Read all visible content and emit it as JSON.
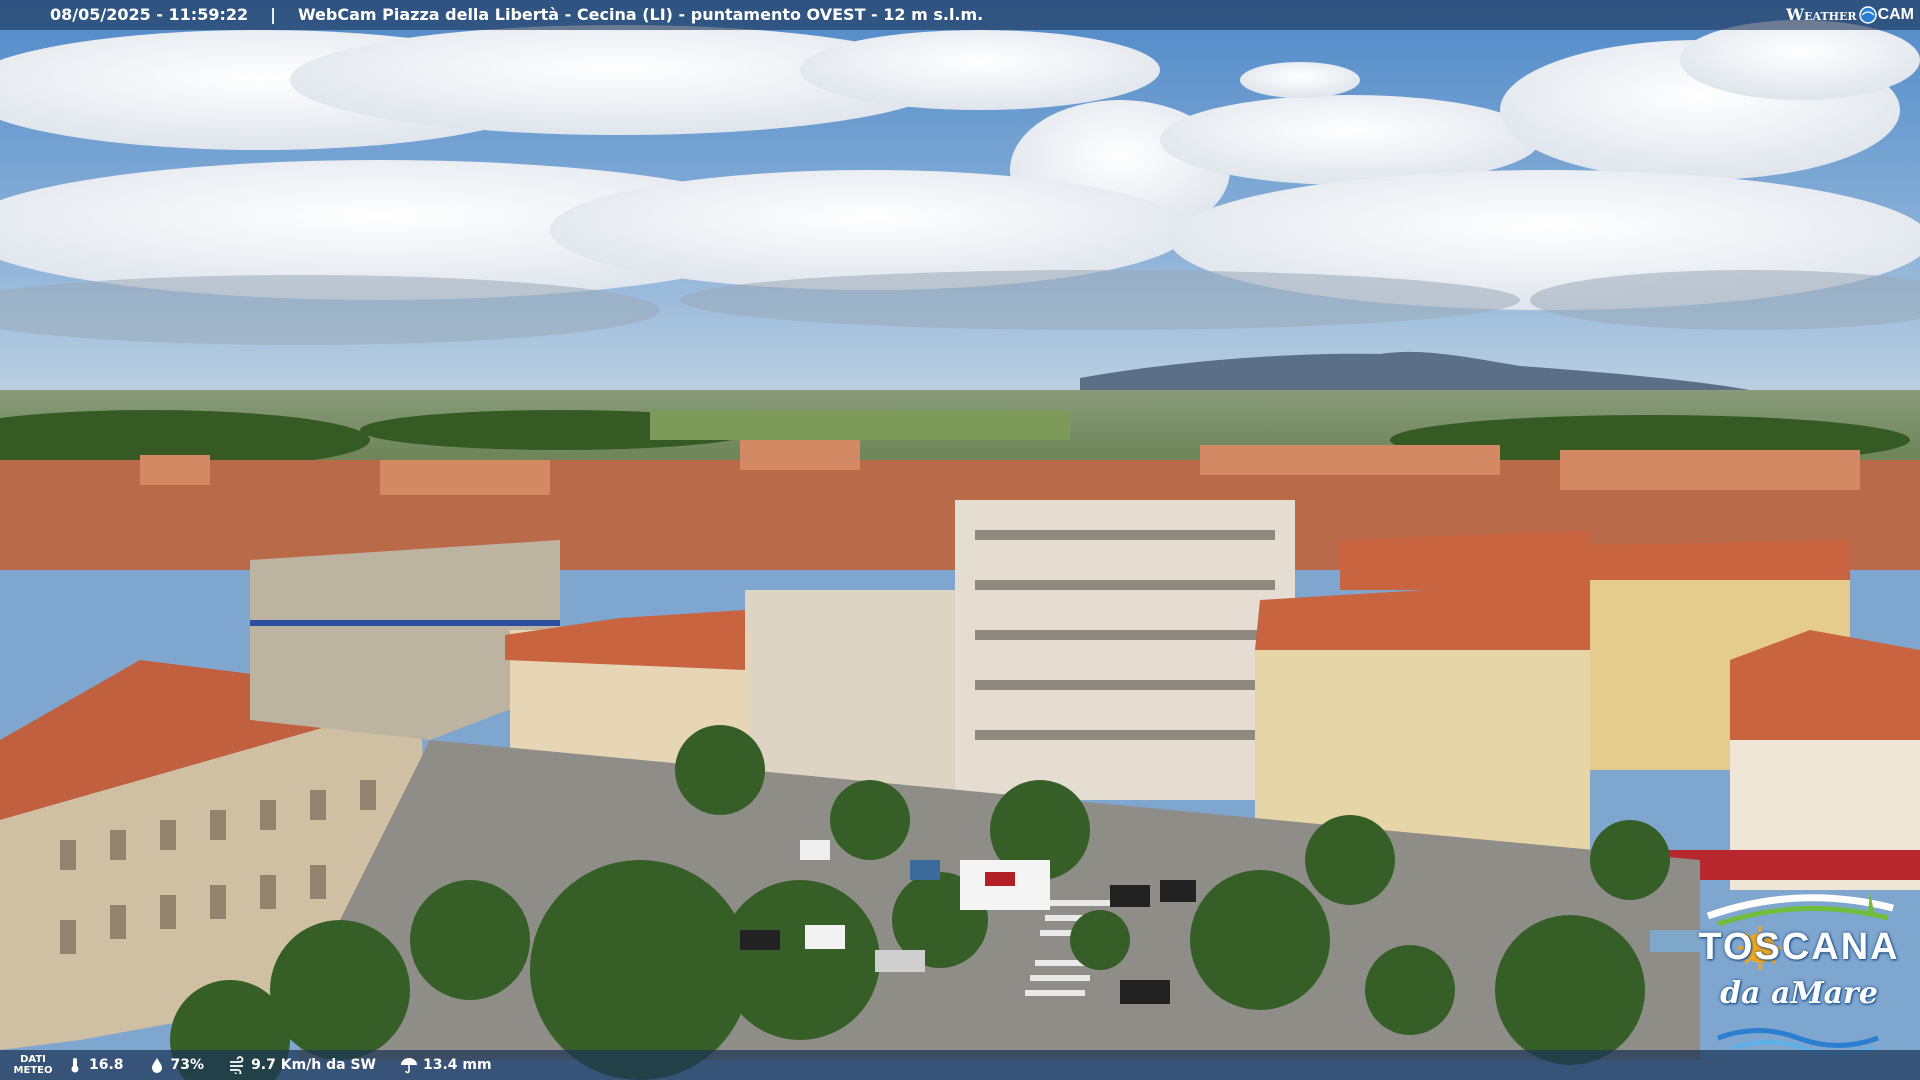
{
  "overlay": {
    "timestamp": "08/05/2025 - 11:59:22",
    "separator": "|",
    "caption": "WebCam Piazza della Libertà - Cecina (LI) - puntamento OVEST - 12 m s.l.m.",
    "logo_part1": "Weather",
    "logo_part2": "CAM",
    "logo_icon": "weathercam-globe-icon"
  },
  "meteo": {
    "label_line1": "DATI",
    "label_line2": "METEO",
    "temperature": "16.8",
    "temperature_icon": "thermometer-icon",
    "humidity": "73%",
    "humidity_icon": "droplet-icon",
    "wind": "9.7 Km/h da SW",
    "wind_icon": "wind-icon",
    "rain": "13.4 mm",
    "rain_icon": "umbrella-icon"
  },
  "brand": {
    "title": "TOSCANA",
    "subtitle": "da aMare",
    "icon": "sun-wave-icon"
  },
  "colors": {
    "sky": "#6f9fd3",
    "roof": "#c8643f",
    "vegetation": "#3f6b2c",
    "overlay_bar": "#1c3456",
    "brand_sun": "#f2a81d"
  }
}
